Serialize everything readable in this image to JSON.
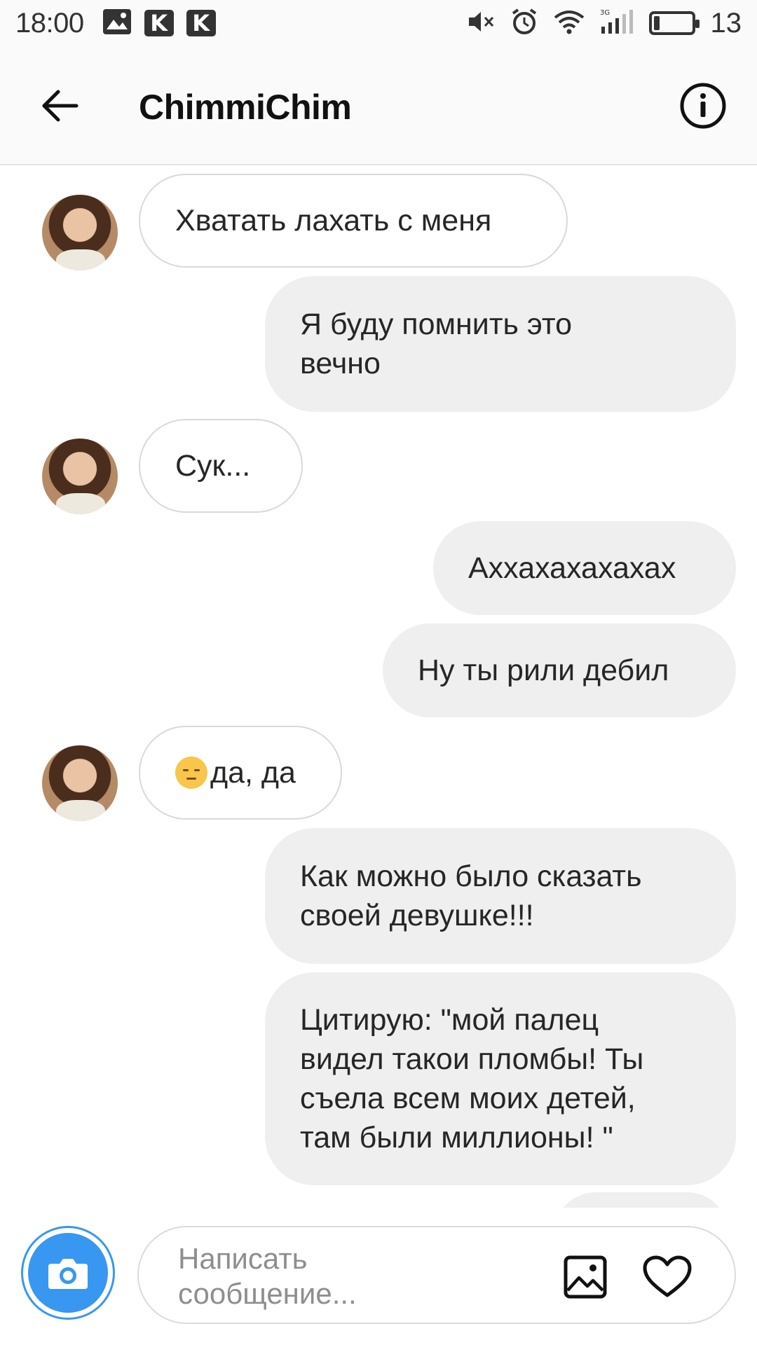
{
  "status_bar": {
    "time": "18:00",
    "left_icons": [
      "image-notification-icon",
      "k-app-icon",
      "k-app-icon"
    ],
    "k_label": "K",
    "right_icons": [
      "mute-icon",
      "alarm-icon",
      "wifi-icon",
      "signal-3g-icon",
      "battery-icon"
    ],
    "network_label": "3G",
    "battery_level": "13"
  },
  "header": {
    "title": "ChimmiChim",
    "back_icon": "back-arrow-icon",
    "info_icon": "info-icon"
  },
  "messages": [
    {
      "direction": "incoming",
      "text": "Хватать лахать с меня"
    },
    {
      "direction": "outgoing",
      "text": "Я буду помнить это\nвечно"
    },
    {
      "direction": "incoming",
      "text": "Сук..."
    },
    {
      "direction": "outgoing",
      "text": "Аххахахахахах"
    },
    {
      "direction": "outgoing",
      "text": "Ну ты рили дебил"
    },
    {
      "direction": "incoming",
      "emoji": "pensive-face",
      "text": "да, да"
    },
    {
      "direction": "outgoing",
      "text": "Как можно было сказать\nсвоей девушке!!!"
    },
    {
      "direction": "outgoing",
      "text": "Цитирую: \"мой палец\nвидел такои пломбы! Ты\nсъела всем моих детей,\nтам были миллионы! \""
    }
  ],
  "composer": {
    "placeholder": "Написать\nсообщение...",
    "camera_icon": "camera-icon",
    "gallery_icon": "gallery-icon",
    "heart_icon": "heart-icon"
  },
  "colors": {
    "accent": "#3897f0",
    "outgoing_bubble": "#efefef",
    "incoming_border": "#d9d9d9",
    "text": "#262626",
    "placeholder": "#8e8e8e"
  }
}
